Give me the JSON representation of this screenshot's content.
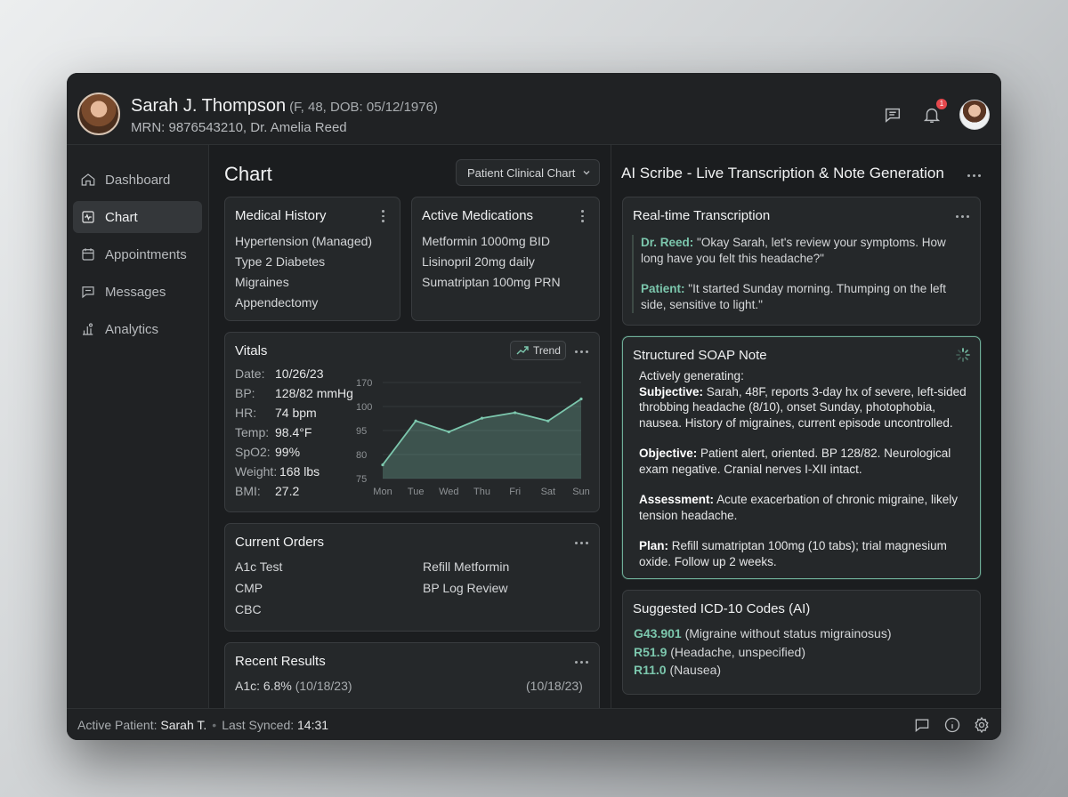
{
  "window": {
    "traffic_colors": [
      "#ff5f57",
      "#febc2e",
      "#28c840"
    ]
  },
  "header": {
    "patient_name": "Sarah J. Thompson",
    "patient_meta": "(F, 48, DOB: 05/12/1976)",
    "mrn_line": "MRN: 9876543210, Dr. Amelia Reed",
    "notification_count": "1"
  },
  "sidebar": {
    "items": [
      {
        "label": "Dashboard",
        "icon": "home-icon"
      },
      {
        "label": "Chart",
        "icon": "chart-pulse-icon"
      },
      {
        "label": "Appointments",
        "icon": "calendar-icon"
      },
      {
        "label": "Messages",
        "icon": "message-icon"
      },
      {
        "label": "Analytics",
        "icon": "bar-chart-icon"
      }
    ],
    "active": "Chart"
  },
  "main": {
    "title": "Chart",
    "view_select": "Patient Clinical Chart",
    "medical_history": {
      "title": "Medical History",
      "items": [
        "Hypertension (Managed)",
        "Type 2 Diabetes",
        "Migraines",
        "Appendectomy"
      ]
    },
    "medications": {
      "title": "Active Medications",
      "items": [
        "Metformin 1000mg BID",
        "Lisinopril 20mg daily",
        "Sumatriptan 100mg PRN"
      ]
    },
    "vitals": {
      "title": "Vitals",
      "trend_label": "Trend",
      "rows": [
        {
          "k": "Date:",
          "v": "10/26/23"
        },
        {
          "k": "BP:",
          "v": "128/82 mmHg"
        },
        {
          "k": "HR:",
          "v": "74 bpm"
        },
        {
          "k": "Temp:",
          "v": "98.4°F"
        },
        {
          "k": "SpO2:",
          "v": "99%"
        },
        {
          "k": "Weight:",
          "v": "168 lbs"
        },
        {
          "k": "BMI:",
          "v": "27.2"
        }
      ]
    },
    "orders": {
      "title": "Current Orders",
      "left": [
        "A1c Test",
        "CMP",
        "CBC"
      ],
      "right": [
        "Refill Metformin",
        "BP Log Review"
      ]
    },
    "results": {
      "title": "Recent Results",
      "row_label": "A1c: 6.8%",
      "row_date_inline": "(10/18/23)",
      "row_date_right": "(10/18/23)"
    }
  },
  "chart_data": {
    "type": "area",
    "categories": [
      "Mon",
      "Tue",
      "Wed",
      "Thu",
      "Fri",
      "Sat",
      "Sun"
    ],
    "values": [
      80,
      96,
      92,
      97,
      99,
      96,
      104
    ],
    "y_ticks": [
      "170",
      "100",
      "95",
      "80",
      "75"
    ],
    "grid": true
  },
  "scribe": {
    "title": "AI Scribe - Live Transcription & Note Generation",
    "transcription": {
      "title": "Real-time Transcription",
      "lines": [
        {
          "speaker": "Dr. Reed:",
          "text": "\"Okay Sarah, let's review your symptoms. How long have you felt this headache?\""
        },
        {
          "speaker": "Patient:",
          "text": "\"It started Sunday morning. Thumping on the left side, sensitive to light.\""
        }
      ]
    },
    "soap": {
      "title": "Structured SOAP Note",
      "status": "Actively generating:",
      "sections": [
        {
          "label": "Subjective:",
          "text": "Sarah, 48F, reports 3-day hx of severe, left-sided throbbing headache (8/10), onset Sunday, photophobia, nausea. History of migraines, current episode uncontrolled."
        },
        {
          "label": "Objective:",
          "text": "Patient alert, oriented. BP 128/82. Neurological exam negative. Cranial nerves I-XII intact."
        },
        {
          "label": "Assessment:",
          "text": "Acute exacerbation of chronic migraine, likely tension headache."
        },
        {
          "label": "Plan:",
          "text": "Refill sumatriptan 100mg (10 tabs); trial magnesium oxide. Follow up 2 weeks."
        }
      ]
    },
    "icd": {
      "title": "Suggested ICD-10 Codes (AI)",
      "codes": [
        {
          "code": "G43.901",
          "desc": "(Migraine without status migrainosus)"
        },
        {
          "code": "R51.9",
          "desc": "(Headache, unspecified)"
        },
        {
          "code": "R11.0",
          "desc": "(Nausea)"
        }
      ]
    }
  },
  "footer": {
    "active_label": "Active Patient:",
    "active_value": "Sarah T.",
    "synced_label": "Last Synced:",
    "synced_value": "14:31"
  },
  "colors": {
    "accent": "#7cc7ad",
    "badge": "#e5484d",
    "background": "#1b1d1f"
  }
}
